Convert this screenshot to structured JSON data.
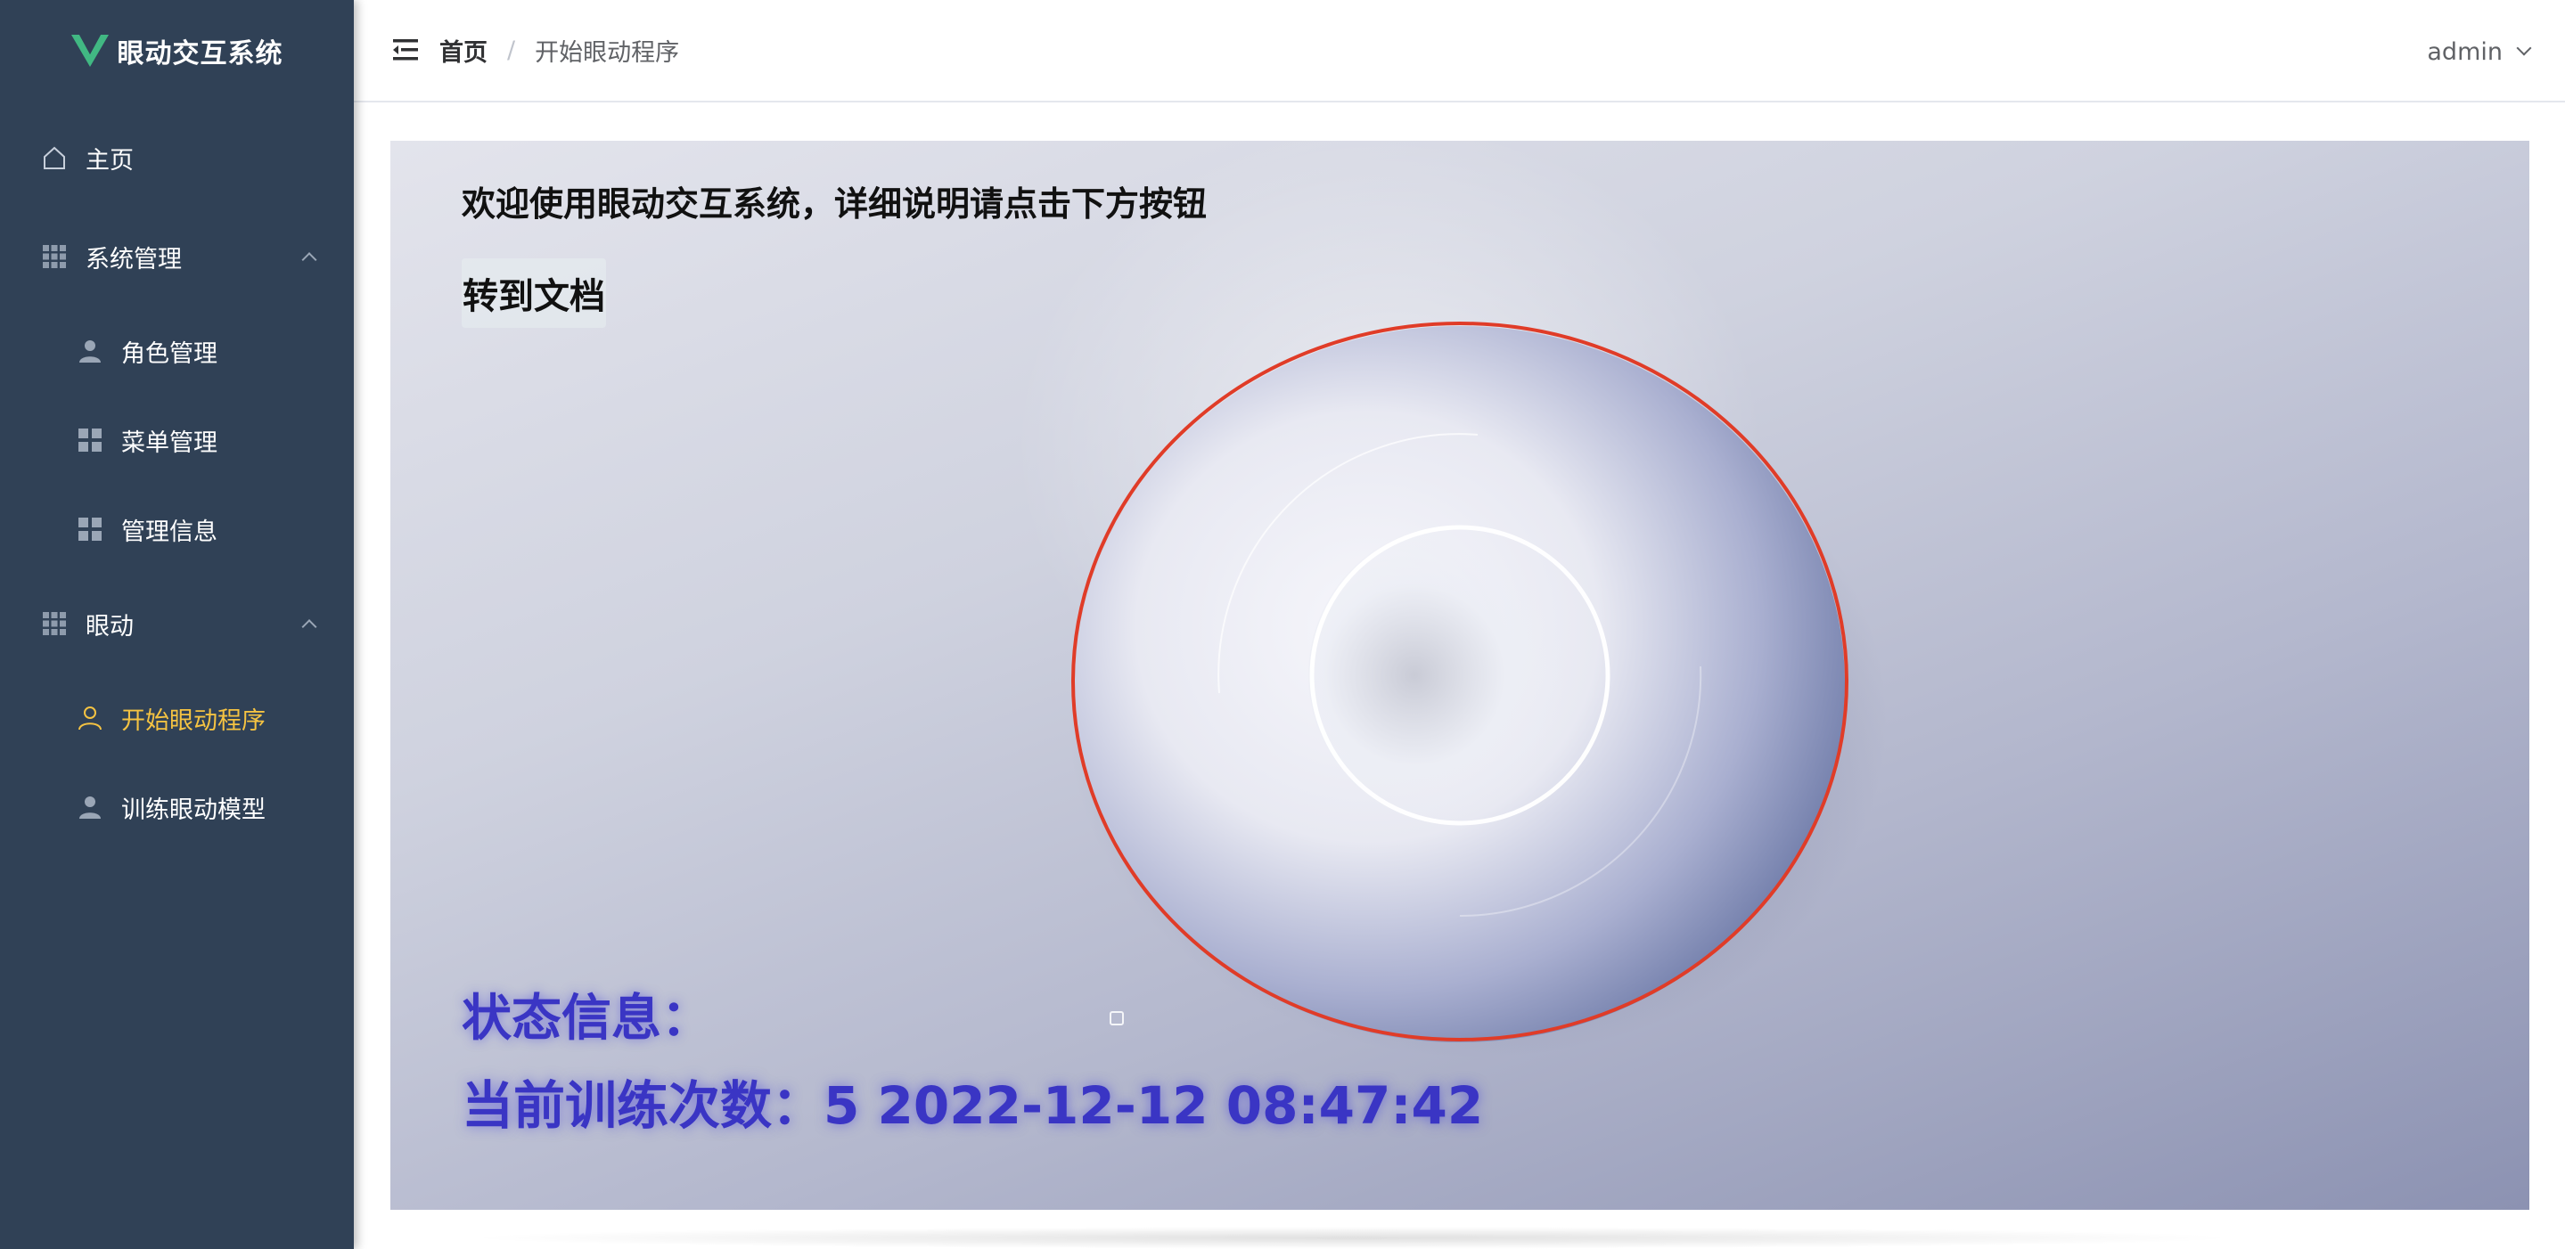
{
  "app": {
    "title": "眼动交互系统",
    "logo_color": "#41b883"
  },
  "sidebar": {
    "items": [
      {
        "label": "主页",
        "icon": "home-icon",
        "level": 1
      },
      {
        "label": "系统管理",
        "icon": "grid-icon",
        "level": 1,
        "expanded": true
      },
      {
        "label": "角色管理",
        "icon": "user-icon",
        "level": 2
      },
      {
        "label": "菜单管理",
        "icon": "tiles-icon",
        "level": 2
      },
      {
        "label": "管理信息",
        "icon": "tiles-icon",
        "level": 2
      },
      {
        "label": "眼动",
        "icon": "grid-icon",
        "level": 1,
        "expanded": true
      },
      {
        "label": "开始眼动程序",
        "icon": "user-outline-icon",
        "level": 2,
        "active": true
      },
      {
        "label": "训练眼动模型",
        "icon": "user-icon",
        "level": 2
      }
    ],
    "background": "#304156",
    "active_color": "#f5c342"
  },
  "header": {
    "breadcrumb": {
      "home": "首页",
      "separator": "/",
      "current": "开始眼动程序"
    },
    "user": "admin"
  },
  "main": {
    "welcome_text": "欢迎使用眼动交互系统，详细说明请点击下方按钮",
    "doc_button": "转到文档",
    "status_title": "状态信息：",
    "status_line": "当前训练次数：5 2022-12-12 08:47:42",
    "status_color": "#3a35c4",
    "pupil_outline_color": "#e03c28"
  }
}
